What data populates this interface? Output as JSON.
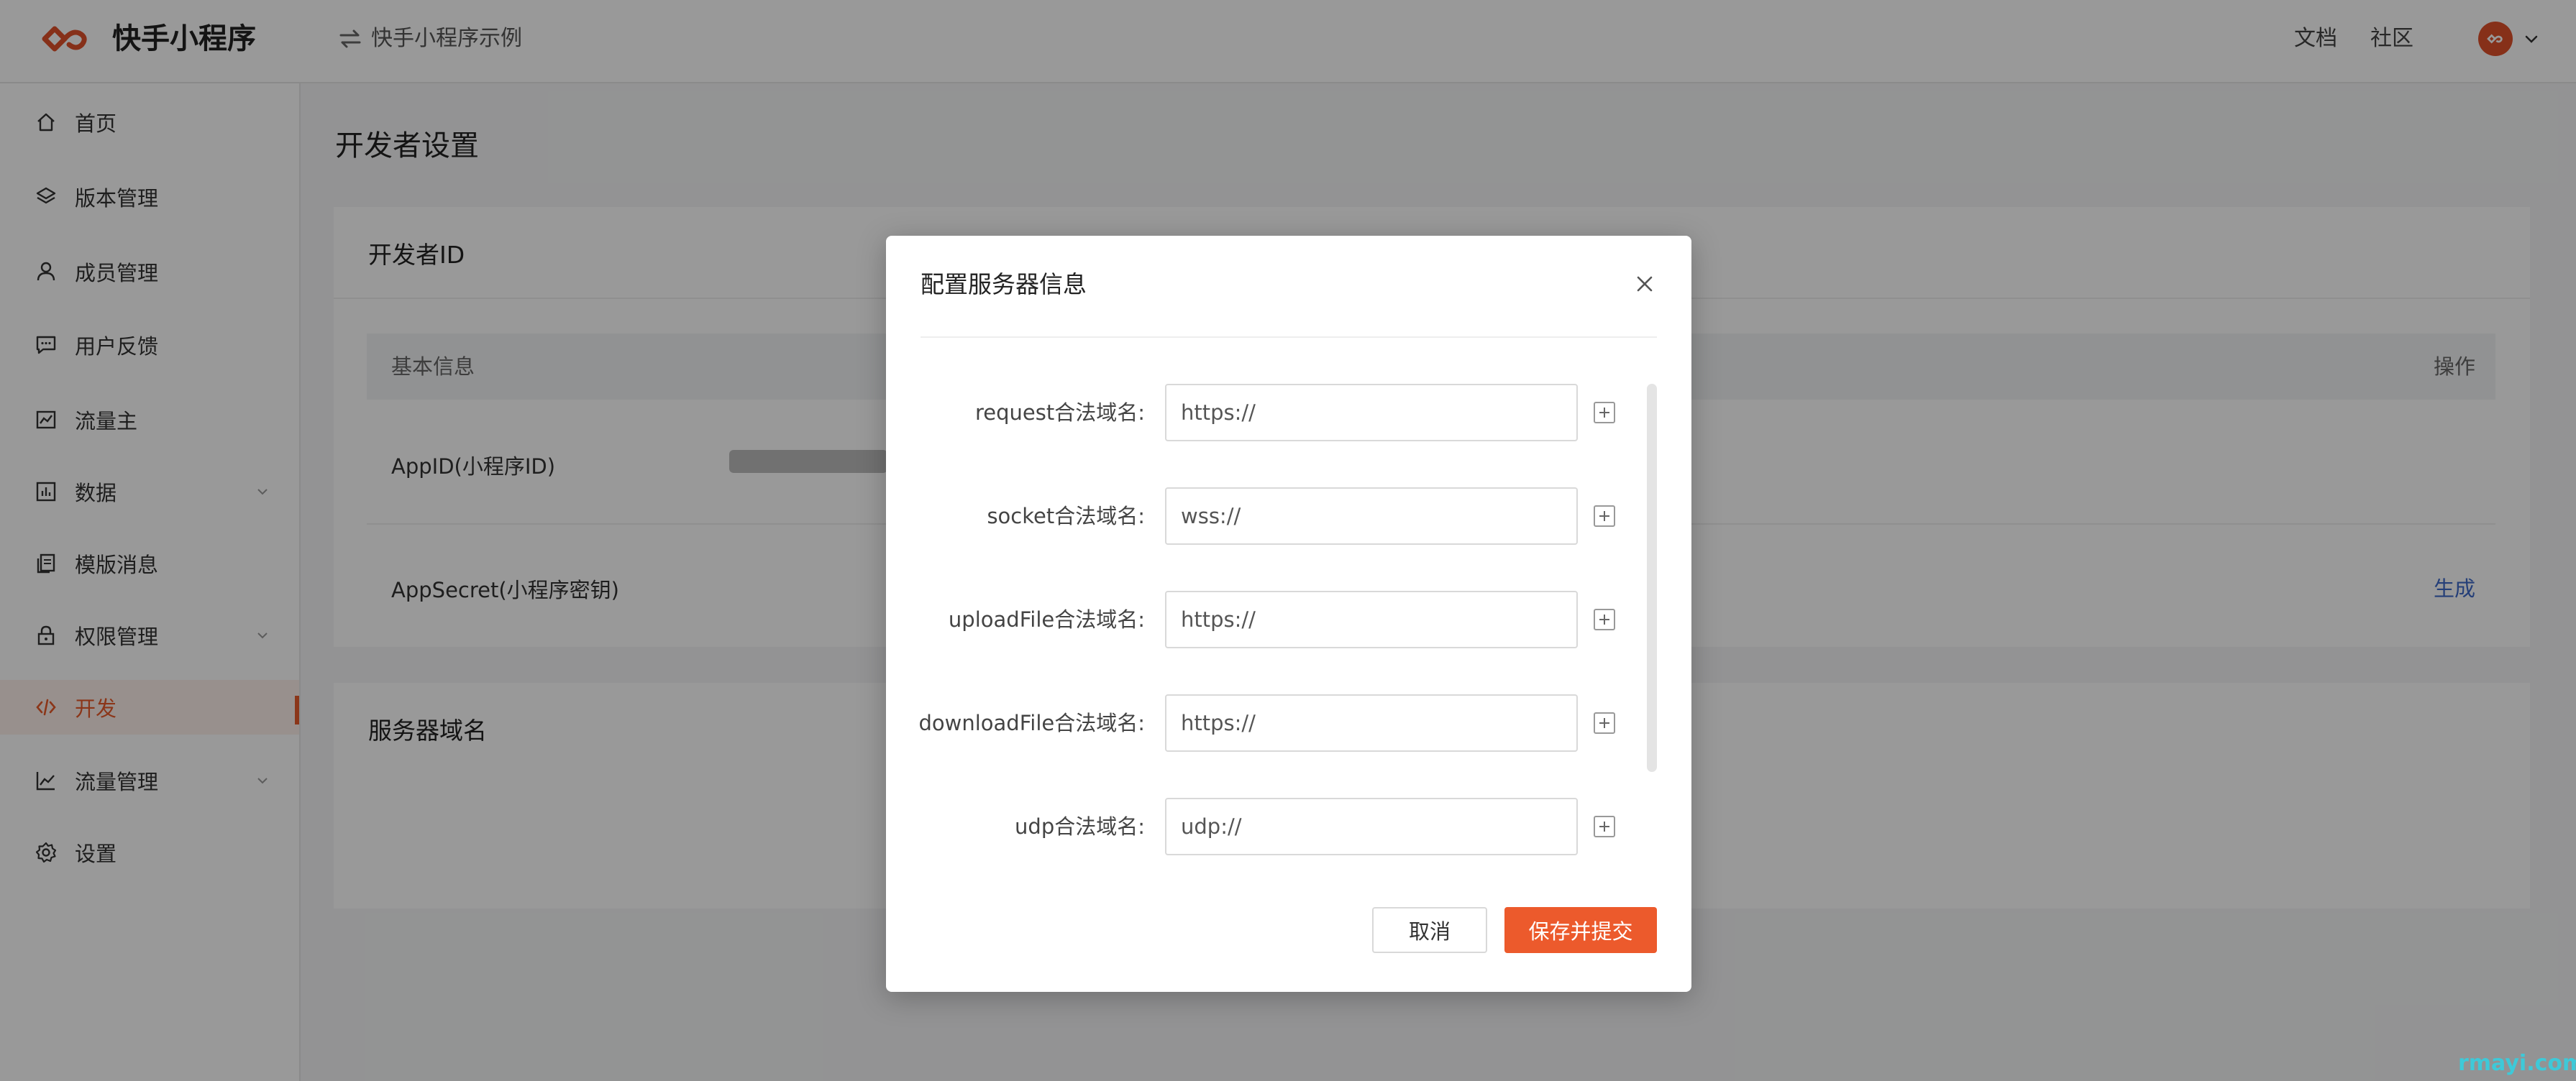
{
  "header": {
    "brand": "快手小程序",
    "app_switch": "快手小程序示例",
    "links": {
      "docs": "文档",
      "community": "社区"
    }
  },
  "sidebar": {
    "items": [
      {
        "label": "首页",
        "icon": "home-icon"
      },
      {
        "label": "版本管理",
        "icon": "layers-icon"
      },
      {
        "label": "成员管理",
        "icon": "user-icon"
      },
      {
        "label": "用户反馈",
        "icon": "message-icon"
      },
      {
        "label": "流量主",
        "icon": "chart-frame-icon"
      },
      {
        "label": "数据",
        "icon": "bar-chart-icon",
        "expandable": true
      },
      {
        "label": "模版消息",
        "icon": "copy-icon"
      },
      {
        "label": "权限管理",
        "icon": "lock-icon",
        "expandable": true
      },
      {
        "label": "开发",
        "icon": "code-icon",
        "active": true
      },
      {
        "label": "流量管理",
        "icon": "line-chart-icon",
        "expandable": true
      },
      {
        "label": "设置",
        "icon": "gear-icon"
      }
    ]
  },
  "main": {
    "page_title": "开发者设置",
    "developer_id_card": {
      "title": "开发者ID",
      "table_header": {
        "info": "基本信息",
        "action": "操作"
      },
      "rows": [
        {
          "label": "AppID(小程序ID)"
        },
        {
          "label": "AppSecret(小程序密钥)",
          "action": "生成"
        }
      ]
    },
    "server_domain_card": {
      "title": "服务器域名"
    }
  },
  "modal": {
    "title": "配置服务器信息",
    "fields": [
      {
        "label": "request合法域名:",
        "placeholder": "https://"
      },
      {
        "label": "socket合法域名:",
        "placeholder": "wss://"
      },
      {
        "label": "uploadFile合法域名:",
        "placeholder": "https://"
      },
      {
        "label": "downloadFile合法域名:",
        "placeholder": "https://"
      },
      {
        "label": "udp合法域名:",
        "placeholder": "udp://"
      }
    ],
    "cancel": "取消",
    "submit": "保存并提交"
  },
  "watermark": "rmayi.com",
  "colors": {
    "accent": "#ec5a2c",
    "link": "#3f6ac9",
    "active_bg": "#fdf0eb"
  }
}
